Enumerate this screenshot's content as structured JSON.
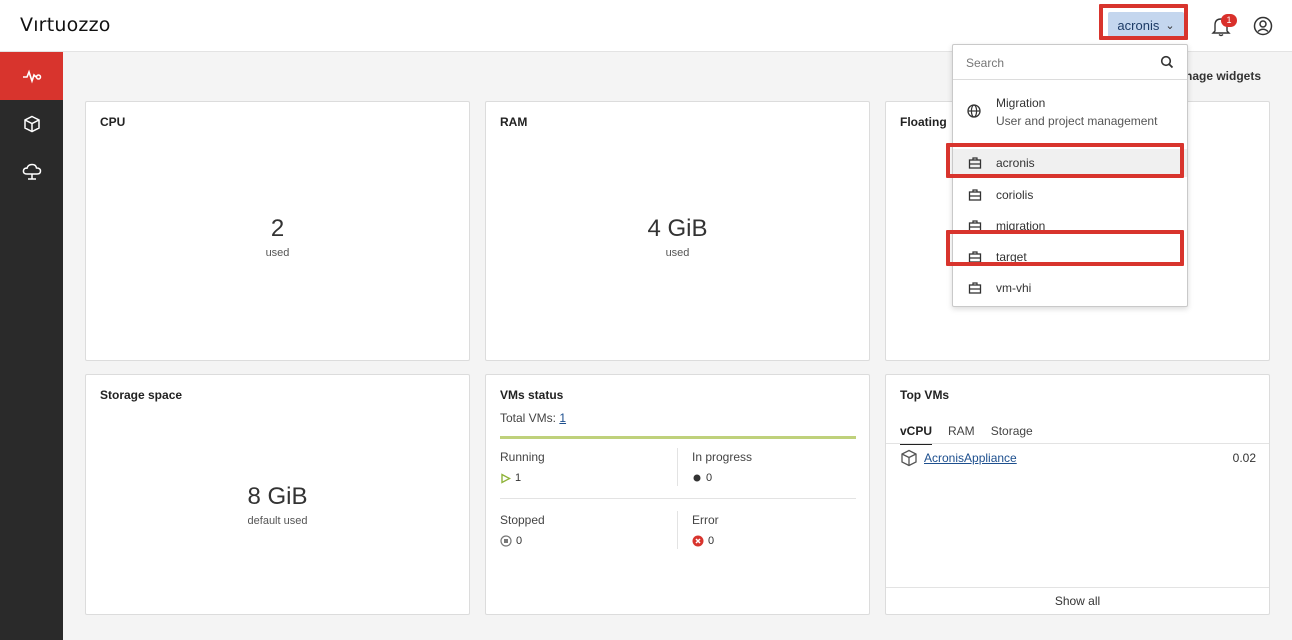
{
  "app": {
    "logo": "Vırtuozzo"
  },
  "header": {
    "project_selector": "acronis",
    "notifications_count": "1"
  },
  "sidebar": {
    "items": [
      {
        "icon": "monitoring-icon",
        "active": true
      },
      {
        "icon": "cube-icon",
        "active": false
      },
      {
        "icon": "cloud-icon",
        "active": false
      }
    ]
  },
  "main": {
    "manage_widgets": "nage widgets",
    "cards": {
      "cpu": {
        "title": "CPU",
        "value": "2",
        "sub": "used"
      },
      "ram": {
        "title": "RAM",
        "value": "4 GiB",
        "sub": "used"
      },
      "floating": {
        "title": "Floating"
      },
      "storage": {
        "title": "Storage space",
        "value": "8 GiB",
        "sub": "default used"
      },
      "vms_status": {
        "title": "VMs status",
        "total_label": "Total VMs:",
        "total_value": "1",
        "running_label": "Running",
        "running_value": "1",
        "in_progress_label": "In progress",
        "in_progress_value": "0",
        "stopped_label": "Stopped",
        "stopped_value": "0",
        "error_label": "Error",
        "error_value": "0"
      },
      "top_vms": {
        "title": "Top VMs",
        "tabs": [
          "vCPU",
          "RAM",
          "Storage"
        ],
        "rows": [
          {
            "name": "AcronisAppliance",
            "value": "0.02"
          }
        ],
        "show_all": "Show all"
      }
    }
  },
  "dropdown": {
    "search_placeholder": "Search",
    "domain": {
      "name": "Migration",
      "description": "User and project management"
    },
    "projects": [
      "acronis",
      "coriolis",
      "migration",
      "target",
      "vm-vhi"
    ],
    "selected": "acronis"
  },
  "colors": {
    "accent_red": "#d8342d",
    "selector_bg": "#c4d6ee",
    "link": "#1d4f8e",
    "progress_green": "#bfd17b",
    "sidebar_bg": "#2a2a2a"
  }
}
